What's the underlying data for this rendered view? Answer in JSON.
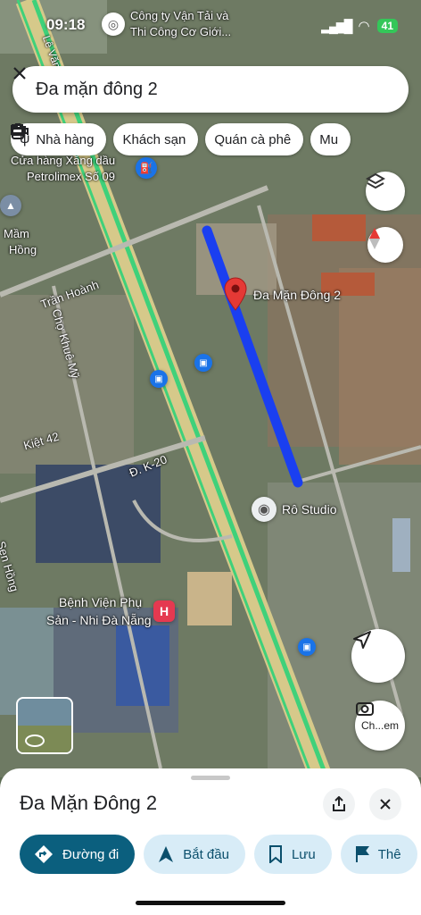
{
  "status_bar": {
    "time": "09:18",
    "battery": "41"
  },
  "search": {
    "query": "Đa mặn đông 2"
  },
  "chips": [
    {
      "label": "Nhà hàng",
      "icon": "fork-knife-icon"
    },
    {
      "label": "Khách sạn",
      "icon": "bed-icon"
    },
    {
      "label": "Quán cà phê",
      "icon": "coffee-cup-icon"
    },
    {
      "label": "Mu",
      "icon": "shopping-bag-icon"
    }
  ],
  "map_labels": {
    "company": "Công ty Vận Tải và",
    "company2": "Thi Công Cơ Giới...",
    "le_van_hien": "Lê Văn Hiến",
    "gas_station": "Cửa hàng Xăng dầu",
    "gas_station2": "Petrolimex Số 09",
    "mam": "Mầm",
    "hong": "Hồng",
    "tran_hoanh": "Trần Hoành",
    "cho_khue_my": "Chợ Khuê Mỹ",
    "kiet42": "Kiệt 42",
    "dk20": "Đ. K-20",
    "sen_hong": "Sen Hồng",
    "hospital": "Bệnh Viện Phụ",
    "hospital2": "Sản - Nhi Đà Nẵng",
    "pin_label": "Đa Mặn Đông 2",
    "ro_studio": "Rô Studio",
    "da": "Đa",
    "vien": "Chợ"
  },
  "street_view_label": "Ch...em",
  "sheet": {
    "title": "Đa Mặn Đông 2",
    "actions": [
      {
        "label": "Đường đi",
        "icon": "directions-icon"
      },
      {
        "label": "Bắt đầu",
        "icon": "navigation-arrow-icon"
      },
      {
        "label": "Lưu",
        "icon": "bookmark-icon"
      },
      {
        "label": "Thê",
        "icon": "flag-icon"
      }
    ]
  },
  "colors": {
    "route": "#1a3ff0",
    "pin": "#e53935",
    "primary": "#0b5f7e"
  }
}
